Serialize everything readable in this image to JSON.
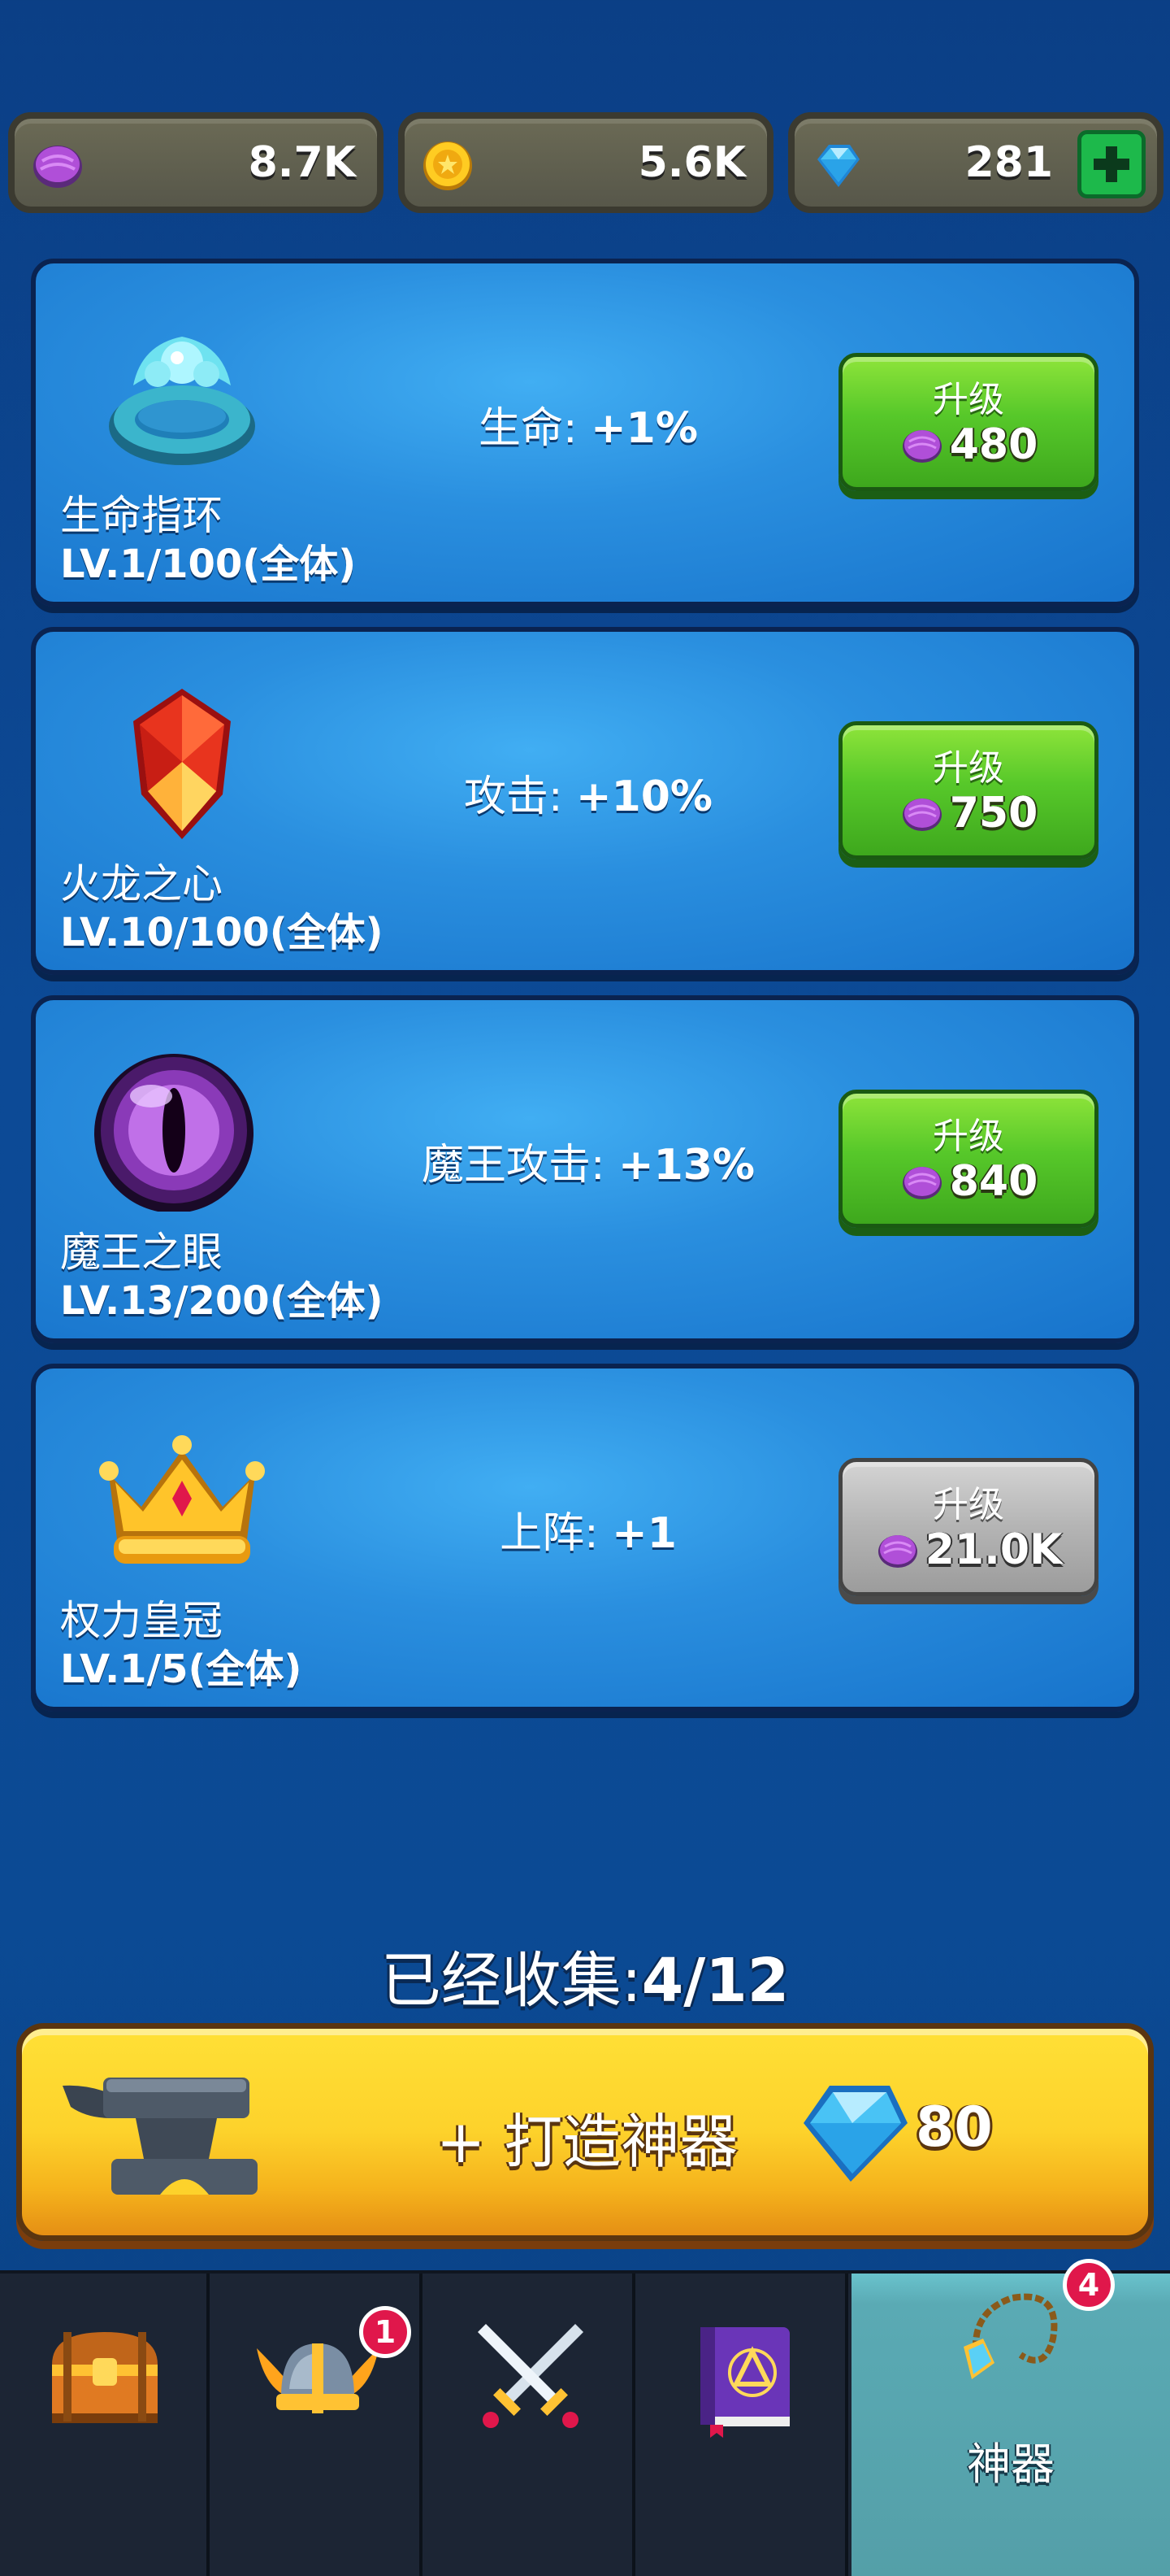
{
  "currencies": {
    "essence": {
      "icon": "purple-essence-icon",
      "value": "8.7K"
    },
    "coins": {
      "icon": "gold-coin-icon",
      "value": "5.6K"
    },
    "gems": {
      "icon": "blue-gem-icon",
      "value": "281"
    }
  },
  "artifacts": [
    {
      "name": "生命指环",
      "level": "LV.1/100(全体)",
      "effect_label": "生命:",
      "effect_value": "+1%",
      "upgrade_label": "升级",
      "cost": "480",
      "affordable": true,
      "icon": "life-ring-icon"
    },
    {
      "name": "火龙之心",
      "level": "LV.10/100(全体)",
      "effect_label": "攻击:",
      "effect_value": "+10%",
      "upgrade_label": "升级",
      "cost": "750",
      "affordable": true,
      "icon": "dragon-heart-icon"
    },
    {
      "name": "魔王之眼",
      "level": "LV.13/200(全体)",
      "effect_label": "魔王攻击:",
      "effect_value": "+13%",
      "upgrade_label": "升级",
      "cost": "840",
      "affordable": true,
      "icon": "demon-eye-icon"
    },
    {
      "name": "权力皇冠",
      "level": "LV.1/5(全体)",
      "effect_label": "上阵:",
      "effect_value": "+1",
      "upgrade_label": "升级",
      "cost": "21.0K",
      "affordable": false,
      "icon": "crown-icon"
    }
  ],
  "collected": {
    "label": "已经收集:",
    "value": "4/12"
  },
  "forge": {
    "label": "+ 打造神器",
    "cost": "80"
  },
  "nav": {
    "items": [
      {
        "icon": "treasure-chest-icon",
        "badge": ""
      },
      {
        "icon": "viking-helmet-icon",
        "badge": "1"
      },
      {
        "icon": "crossed-swords-icon",
        "badge": ""
      },
      {
        "icon": "spellbook-icon",
        "badge": ""
      },
      {
        "icon": "amulet-icon",
        "badge": "4",
        "label": "神器",
        "active": true
      }
    ]
  }
}
